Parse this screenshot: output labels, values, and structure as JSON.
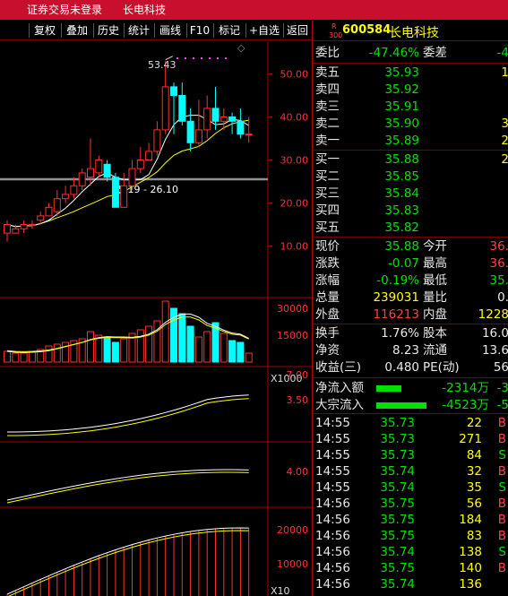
{
  "topbar": {
    "login": "证券交易未登录",
    "name": "长电科技"
  },
  "toolbar": [
    "复权",
    "叠加",
    "历史",
    "统计",
    "画线",
    "F10",
    "标记",
    "+自选",
    "返回"
  ],
  "quote": {
    "code": "600584",
    "name": "长电科技",
    "flag_top": "R",
    "flag_bottom": "300",
    "weibi_label": "委比",
    "weibi": "-47.46%",
    "weicha_label": "委差",
    "weicha": "-4",
    "asks": [
      {
        "label": "卖五",
        "price": "35.93",
        "vol": "1"
      },
      {
        "label": "卖四",
        "price": "35.92",
        "vol": ""
      },
      {
        "label": "卖三",
        "price": "35.91",
        "vol": ""
      },
      {
        "label": "卖二",
        "price": "35.90",
        "vol": "3"
      },
      {
        "label": "卖一",
        "price": "35.89",
        "vol": "2"
      }
    ],
    "bids": [
      {
        "label": "买一",
        "price": "35.88",
        "vol": "2"
      },
      {
        "label": "买二",
        "price": "35.85",
        "vol": ""
      },
      {
        "label": "买三",
        "price": "35.84",
        "vol": ""
      },
      {
        "label": "买四",
        "price": "35.83",
        "vol": ""
      },
      {
        "label": "买五",
        "price": "35.82",
        "vol": ""
      }
    ],
    "stats": [
      {
        "l1": "现价",
        "v1": "35.88",
        "l2": "今开",
        "v2": "36."
      },
      {
        "l1": "涨跌",
        "v1": "-0.07",
        "l2": "最高",
        "v2": "36."
      },
      {
        "l1": "涨幅",
        "v1": "-0.19%",
        "l2": "最低",
        "v2": "35."
      },
      {
        "l1": "总量",
        "v1": "239031",
        "l2": "量比",
        "v2": "0."
      },
      {
        "l1": "外盘",
        "v1": "116213",
        "l2": "内盘",
        "v2": "1228"
      }
    ],
    "stats2": [
      {
        "l1": "换手",
        "v1": "1.76%",
        "l2": "股本",
        "v2": "16.0"
      },
      {
        "l1": "净资",
        "v1": "8.23",
        "l2": "流通",
        "v2": "13.6"
      },
      {
        "l1": "收益(三)",
        "v1": "0.480",
        "l2": "PE(动)",
        "v2": "56"
      }
    ],
    "flows": [
      {
        "label": "净流入额",
        "value": "-2314万",
        "extra": "-3"
      },
      {
        "label": "大宗流入",
        "value": "-4523万",
        "extra": "-5"
      }
    ],
    "ticks": [
      {
        "t": "14:55",
        "p": "35.73",
        "v": "22",
        "s": "B"
      },
      {
        "t": "14:55",
        "p": "35.73",
        "v": "271",
        "s": "B"
      },
      {
        "t": "14:55",
        "p": "35.73",
        "v": "84",
        "s": "S"
      },
      {
        "t": "14:55",
        "p": "35.74",
        "v": "32",
        "s": "B"
      },
      {
        "t": "14:55",
        "p": "35.74",
        "v": "35",
        "s": "S"
      },
      {
        "t": "14:56",
        "p": "35.75",
        "v": "56",
        "s": "B"
      },
      {
        "t": "14:56",
        "p": "35.75",
        "v": "184",
        "s": "B"
      },
      {
        "t": "14:56",
        "p": "35.75",
        "v": "83",
        "s": "B"
      },
      {
        "t": "14:56",
        "p": "35.74",
        "v": "138",
        "s": "S"
      },
      {
        "t": "14:56",
        "p": "35.75",
        "v": "140",
        "s": "B"
      },
      {
        "t": "14:56",
        "p": "35.74",
        "v": "136",
        "s": ""
      }
    ]
  },
  "chart": {
    "price_ticks": [
      "50.00",
      "40.00",
      "30.00",
      "20.00",
      "10.00"
    ],
    "high_label": "53.43",
    "range_label": "25.19 - 26.10",
    "vol_ticks": [
      "30000",
      "15000"
    ],
    "vol_unit": "X1000",
    "p3_ticks": [
      "7.00",
      "3.50"
    ],
    "p4_ticks": [
      "4.00"
    ],
    "p5_ticks": [
      "20000",
      "10000"
    ],
    "p5_unit": "X10",
    "colors": {
      "up": "#ff3030",
      "down": "#00ffff",
      "ma1": "#ffffff",
      "ma2": "#ffff00",
      "ma3": "#ff40ff"
    },
    "candles": [
      [
        13,
        15,
        11,
        16
      ],
      [
        13,
        14,
        13,
        15
      ],
      [
        14,
        15,
        13,
        16
      ],
      [
        15,
        15,
        14,
        16
      ],
      [
        16,
        17,
        15,
        18
      ],
      [
        17,
        19,
        17,
        20
      ],
      [
        18,
        21,
        17,
        23
      ],
      [
        21,
        22,
        20,
        24
      ],
      [
        22,
        24,
        21,
        26
      ],
      [
        24,
        27,
        23,
        28
      ],
      [
        26,
        28,
        24,
        35
      ],
      [
        27,
        30,
        26,
        31
      ],
      [
        29,
        26,
        25,
        30
      ],
      [
        26,
        19,
        19,
        27
      ],
      [
        19,
        24,
        19,
        27
      ],
      [
        24,
        28,
        23,
        30
      ],
      [
        28,
        30,
        27,
        33
      ],
      [
        30,
        32,
        30,
        34
      ],
      [
        32,
        37,
        31,
        39
      ],
      [
        37,
        47,
        36,
        53
      ],
      [
        47,
        45,
        36,
        48
      ],
      [
        45,
        39,
        38,
        48
      ],
      [
        39,
        34,
        32,
        42
      ],
      [
        34,
        37,
        33,
        44
      ],
      [
        37,
        42,
        35,
        45
      ],
      [
        42,
        39,
        37,
        47
      ],
      [
        39,
        40,
        37,
        42
      ],
      [
        40,
        39,
        36,
        41
      ],
      [
        39,
        36,
        35,
        42
      ],
      [
        36,
        36,
        34,
        40
      ]
    ],
    "volumes": [
      6,
      5,
      5,
      6,
      7,
      9,
      10,
      11,
      12,
      13,
      17,
      15,
      14,
      11,
      13,
      16,
      18,
      20,
      23,
      34,
      30,
      27,
      20,
      14,
      17,
      22,
      16,
      12,
      11,
      5
    ]
  }
}
